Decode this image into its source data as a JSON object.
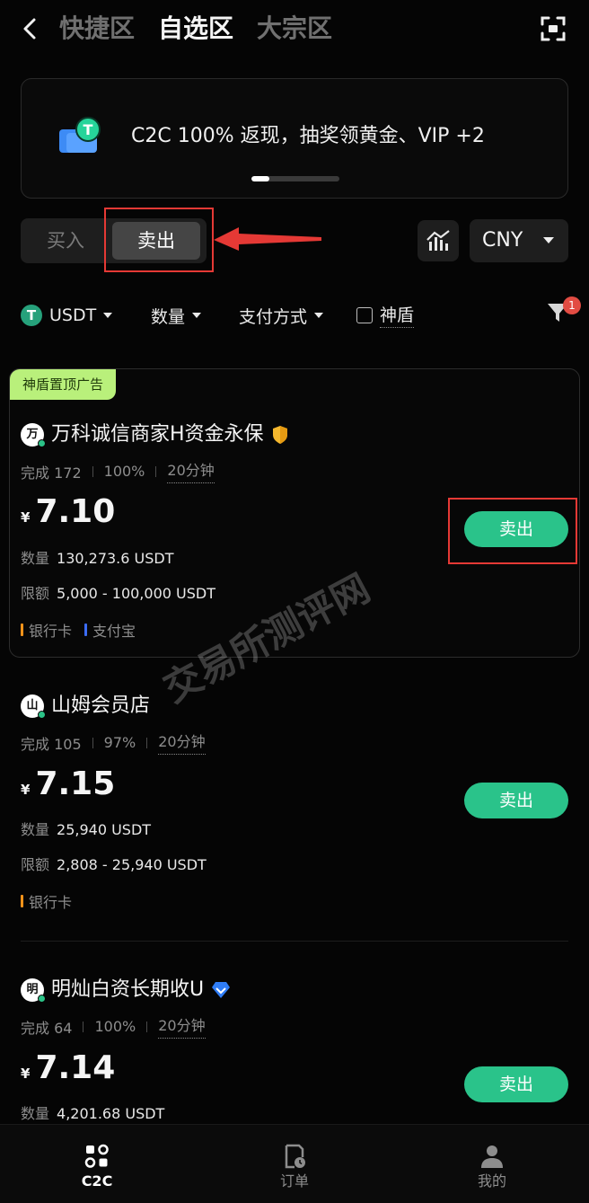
{
  "header": {
    "tabs": [
      {
        "label": "快捷区",
        "active": false
      },
      {
        "label": "自选区",
        "active": true
      },
      {
        "label": "大宗区",
        "active": false
      }
    ]
  },
  "banner": {
    "text": "C2C 100% 返现，抽奖领黄金、VIP +2"
  },
  "trade_toggle": {
    "buy_label": "买入",
    "sell_label": "卖出",
    "selected": "sell"
  },
  "currency": {
    "selected": "CNY"
  },
  "filters": {
    "coin": "USDT",
    "amount": "数量",
    "payment": "支付方式",
    "shield": "神盾",
    "filter_count": "1"
  },
  "ads": [
    {
      "promo": "神盾置顶广告",
      "avatar_text": "万",
      "name": "万科诚信商家H资金永保",
      "badge_icon": "shield-icon",
      "stats": {
        "completed": "完成 172",
        "rate": "100%",
        "time": "20分钟"
      },
      "currency_symbol": "¥",
      "price": "7.10",
      "quantity_label": "数量",
      "quantity": "130,273.6 USDT",
      "limit_label": "限额",
      "limit": "5,000 - 100,000 USDT",
      "payments": [
        {
          "label": "银行卡",
          "color": "#f7931a"
        },
        {
          "label": "支付宝",
          "color": "#3b6cf6"
        }
      ],
      "action": "卖出"
    },
    {
      "avatar_text": "山",
      "name": "山姆会员店",
      "stats": {
        "completed": "完成 105",
        "rate": "97%",
        "time": "20分钟"
      },
      "currency_symbol": "¥",
      "price": "7.15",
      "quantity_label": "数量",
      "quantity": "25,940 USDT",
      "limit_label": "限额",
      "limit": "2,808 - 25,940 USDT",
      "payments": [
        {
          "label": "银行卡",
          "color": "#f7931a"
        }
      ],
      "action": "卖出"
    },
    {
      "avatar_text": "明",
      "name": "明灿白资长期收U",
      "badge_icon": "diamond-icon",
      "stats": {
        "completed": "完成 64",
        "rate": "100%",
        "time": "20分钟"
      },
      "currency_symbol": "¥",
      "price": "7.14",
      "quantity_label": "数量",
      "quantity": "4,201.68 USDT",
      "action": "卖出"
    }
  ],
  "watermark": "交易所测评网",
  "bottom_nav": [
    {
      "label": "C2C",
      "icon": "c2c-icon",
      "active": true
    },
    {
      "label": "订单",
      "icon": "order-icon",
      "active": false
    },
    {
      "label": "我的",
      "icon": "profile-icon",
      "active": false
    }
  ],
  "colors": {
    "accent_green": "#2ac38a",
    "annotation_red": "#e53935",
    "promo_tag": "#b9f07b",
    "usdt_green": "#26a17b"
  }
}
